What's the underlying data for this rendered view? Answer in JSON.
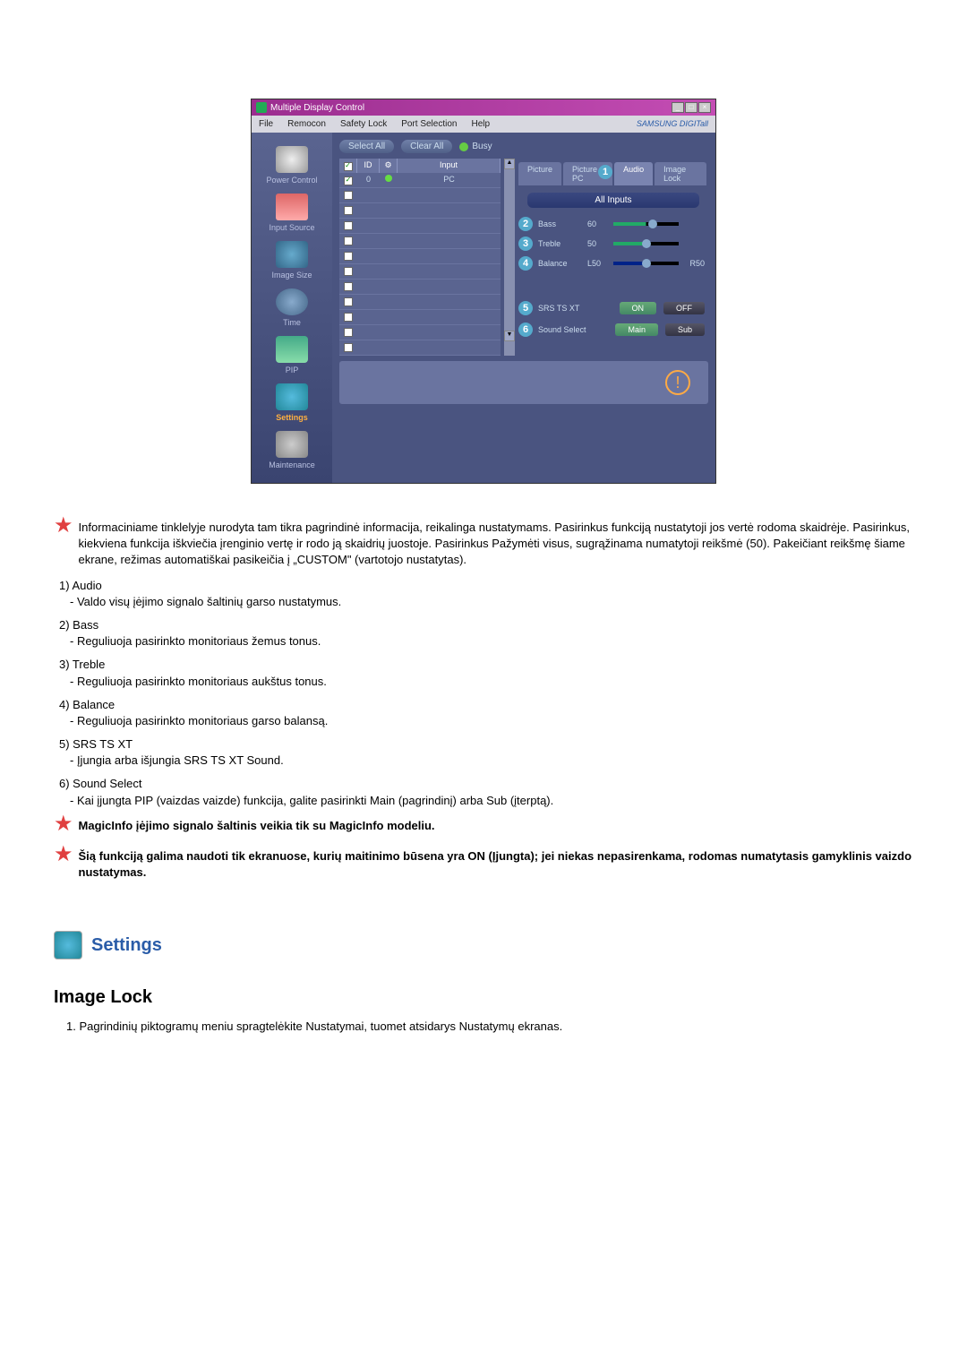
{
  "window": {
    "title": "Multiple Display Control",
    "menu": [
      "File",
      "Remocon",
      "Safety Lock",
      "Port Selection",
      "Help"
    ],
    "brand": "SAMSUNG DIGITall"
  },
  "sidebar": {
    "items": [
      {
        "label": "Power Control"
      },
      {
        "label": "Input Source"
      },
      {
        "label": "Image Size"
      },
      {
        "label": "Time"
      },
      {
        "label": "PIP"
      },
      {
        "label": "Settings"
      },
      {
        "label": "Maintenance"
      }
    ]
  },
  "toolbar": {
    "select_all": "Select All",
    "clear_all": "Clear All",
    "busy": "Busy"
  },
  "table": {
    "headers": {
      "chk": "",
      "id": "ID",
      "dot": "",
      "input": "Input"
    },
    "row": {
      "id": "0",
      "input": "PC"
    }
  },
  "tabs": [
    "Picture",
    "Picture PC",
    "Audio",
    "Image Lock"
  ],
  "all_inputs": "All Inputs",
  "controls": {
    "bass": {
      "label": "Bass",
      "val": "60"
    },
    "treble": {
      "label": "Treble",
      "val": "50"
    },
    "balance": {
      "label": "Balance",
      "val": "L50",
      "end": "R50"
    },
    "srs": {
      "label": "SRS TS XT",
      "on": "ON",
      "off": "OFF"
    },
    "sound": {
      "label": "Sound Select",
      "main": "Main",
      "sub": "Sub"
    }
  },
  "markers": {
    "m1": "1",
    "m2": "2",
    "m3": "3",
    "m4": "4",
    "m5": "5",
    "m6": "6"
  },
  "doc": {
    "intro": "Informaciniame tinklelyje nurodyta tam tikra pagrindinė informacija, reikalinga nustatymams. Pasirinkus funkciją nustatytoji jos vertė rodoma skaidrėje. Pasirinkus, kiekviena funkcija iškviečia įrenginio vertę ir rodo ją skaidrių juostoje. Pasirinkus Pažymėti visus, sugrąžinama numatytoji reikšmė (50). Pakeičiant reikšmę šiame ekrane, režimas automatiškai pasikeičia į „CUSTOM\" (vartotojo nustatytas).",
    "items": [
      {
        "t": "1) Audio",
        "d": "- Valdo visų įėjimo signalo šaltinių garso nustatymus."
      },
      {
        "t": "2) Bass",
        "d": "- Reguliuoja pasirinkto monitoriaus žemus tonus."
      },
      {
        "t": "3) Treble",
        "d": "- Reguliuoja pasirinkto monitoriaus aukštus tonus."
      },
      {
        "t": "4) Balance",
        "d": "- Reguliuoja pasirinkto monitoriaus garso balansą."
      },
      {
        "t": "5) SRS TS XT",
        "d": "- Įjungia arba išjungia SRS TS XT Sound."
      },
      {
        "t": "6) Sound Select",
        "d": "- Kai įjungta PIP (vaizdas vaizde) funkcija, galite pasirinkti Main (pagrindinį) arba Sub (įterptą)."
      }
    ],
    "note1": "MagicInfo įėjimo signalo šaltinis veikia tik su MagicInfo modeliu.",
    "note2": "Šią funkciją galima naudoti tik ekranuose, kurių maitinimo būsena yra ON (Įjungta); jei niekas nepasirenkama, rodomas numatytasis gamyklinis vaizdo nustatymas.",
    "section": "Settings",
    "subsection": "Image Lock",
    "step1": "1.  Pagrindinių piktogramų meniu spragtelėkite Nustatymai, tuomet atsidarys Nustatymų ekranas."
  }
}
